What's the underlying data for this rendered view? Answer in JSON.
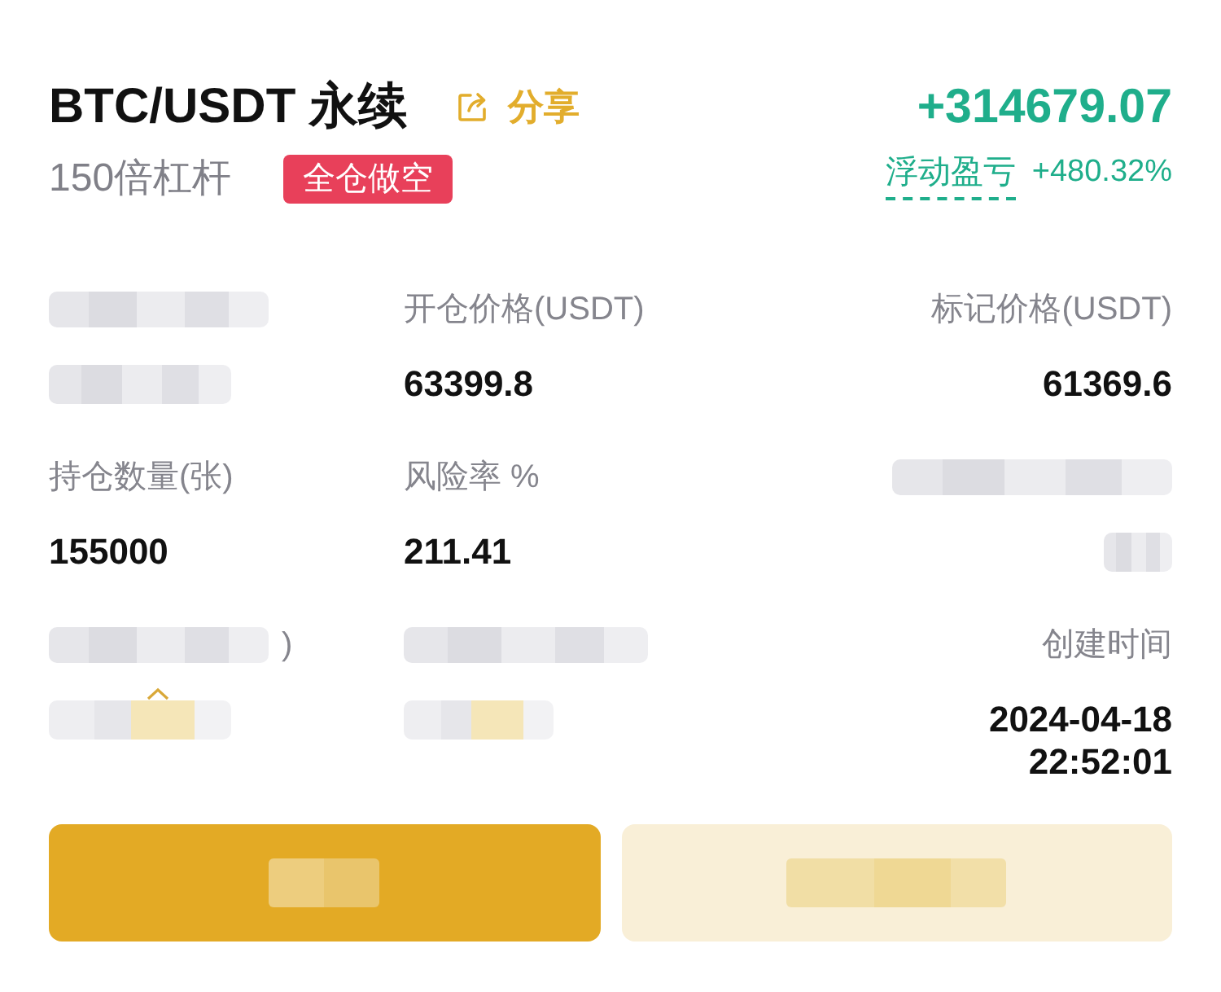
{
  "header": {
    "title": "BTC/USDT 永续",
    "share_label": "分享",
    "pnl": "+314679.07",
    "leverage": "150倍杠杆",
    "margin_badge": "全仓做空",
    "pnl_label": "浮动盈亏",
    "pnl_ratio": "+480.32%"
  },
  "fields": [
    {
      "kind": "redacted",
      "accent": false,
      "caret": false
    },
    {
      "kind": "text",
      "label": "开仓价格(USDT)",
      "value": "63399.8"
    },
    {
      "kind": "text",
      "label": "标记价格(USDT)",
      "value": "61369.6"
    },
    {
      "kind": "text",
      "label": "持仓数量(张)",
      "value": "155000"
    },
    {
      "kind": "text",
      "label": "风险率 %",
      "value": "211.41"
    },
    {
      "kind": "redacted",
      "accent": false,
      "caret": false
    },
    {
      "kind": "redacted",
      "label_tail": ")",
      "accent": true,
      "caret": true
    },
    {
      "kind": "redacted",
      "accent": true,
      "caret": false
    },
    {
      "kind": "datetime",
      "label": "创建时间",
      "date": "2024-04-18",
      "time": "22:52:01"
    }
  ],
  "buttons": [
    {
      "kind": "primary"
    },
    {
      "kind": "secondary"
    }
  ]
}
